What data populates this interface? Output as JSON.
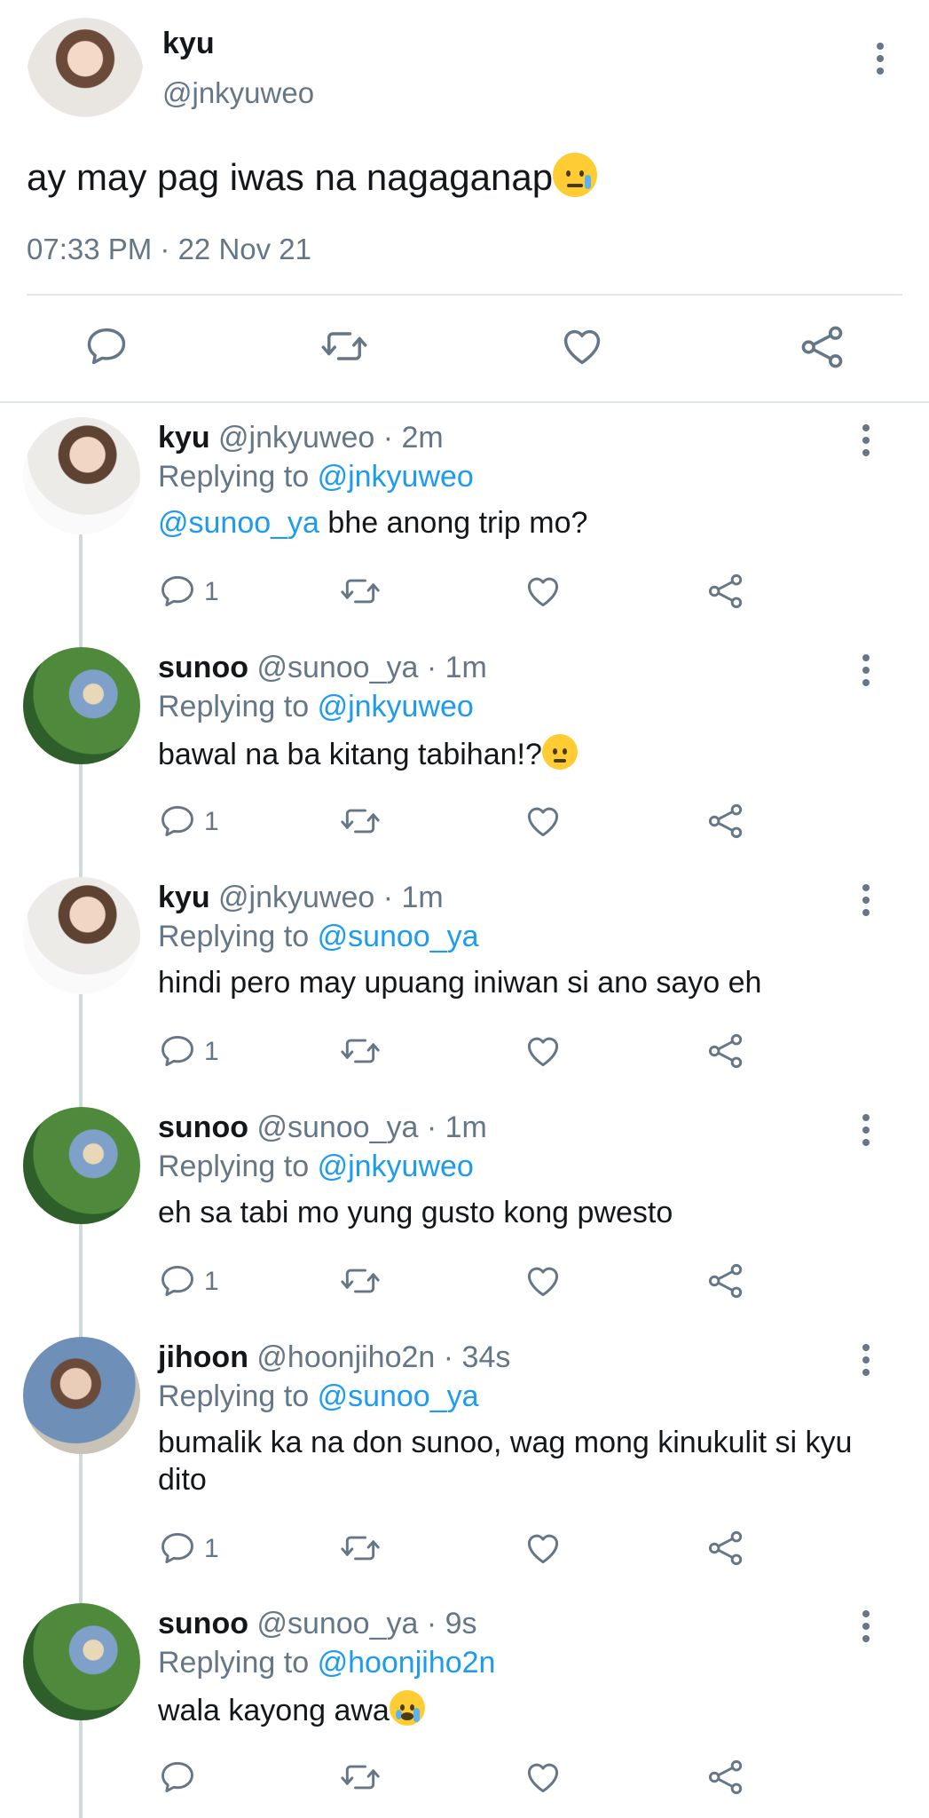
{
  "main_tweet": {
    "name": "kyu",
    "handle": "@jnkyuweo",
    "text": "ay may pag iwas na nagaganap",
    "emoji": "smiling-face-with-tear",
    "timestamp": "07:33 PM · 22 Nov 21"
  },
  "replies": [
    {
      "name": "kyu",
      "meta": "@jnkyuweo · 2m",
      "replying_label": "Replying to",
      "replying_to": "@jnkyuweo",
      "mention": "@sunoo_ya",
      "text": " bhe anong trip mo?",
      "reply_count": "1"
    },
    {
      "name": "sunoo",
      "meta": "@sunoo_ya · 1m",
      "replying_label": "Replying to",
      "replying_to": "@jnkyuweo",
      "text": "bawal na ba kitang tabihan!?",
      "emoji": "face-with-raised-eyebrow",
      "reply_count": "1"
    },
    {
      "name": "kyu",
      "meta": "@jnkyuweo · 1m",
      "replying_label": "Replying to",
      "replying_to": "@sunoo_ya",
      "text": "hindi pero may upuang iniwan si ano sayo eh",
      "reply_count": "1"
    },
    {
      "name": "sunoo",
      "meta": "@sunoo_ya · 1m",
      "replying_label": "Replying to",
      "replying_to": "@jnkyuweo",
      "text": "eh sa tabi mo yung gusto kong pwesto",
      "reply_count": "1"
    },
    {
      "name": "jihoon",
      "meta": "@hoonjiho2n · 34s",
      "replying_label": "Replying to",
      "replying_to": "@sunoo_ya",
      "text": "bumalik ka na don sunoo, wag mong kinukulit si kyu dito",
      "reply_count": "1"
    },
    {
      "name": "sunoo",
      "meta": "@sunoo_ya · 9s",
      "replying_label": "Replying to",
      "replying_to": "@hoonjiho2n",
      "text": "wala kayong awa",
      "emoji": "loudly-crying-face",
      "reply_count": ""
    }
  ],
  "colors": {
    "link": "#1d9bf0",
    "secondary_text": "#657786",
    "divider": "#e1e8ed"
  }
}
